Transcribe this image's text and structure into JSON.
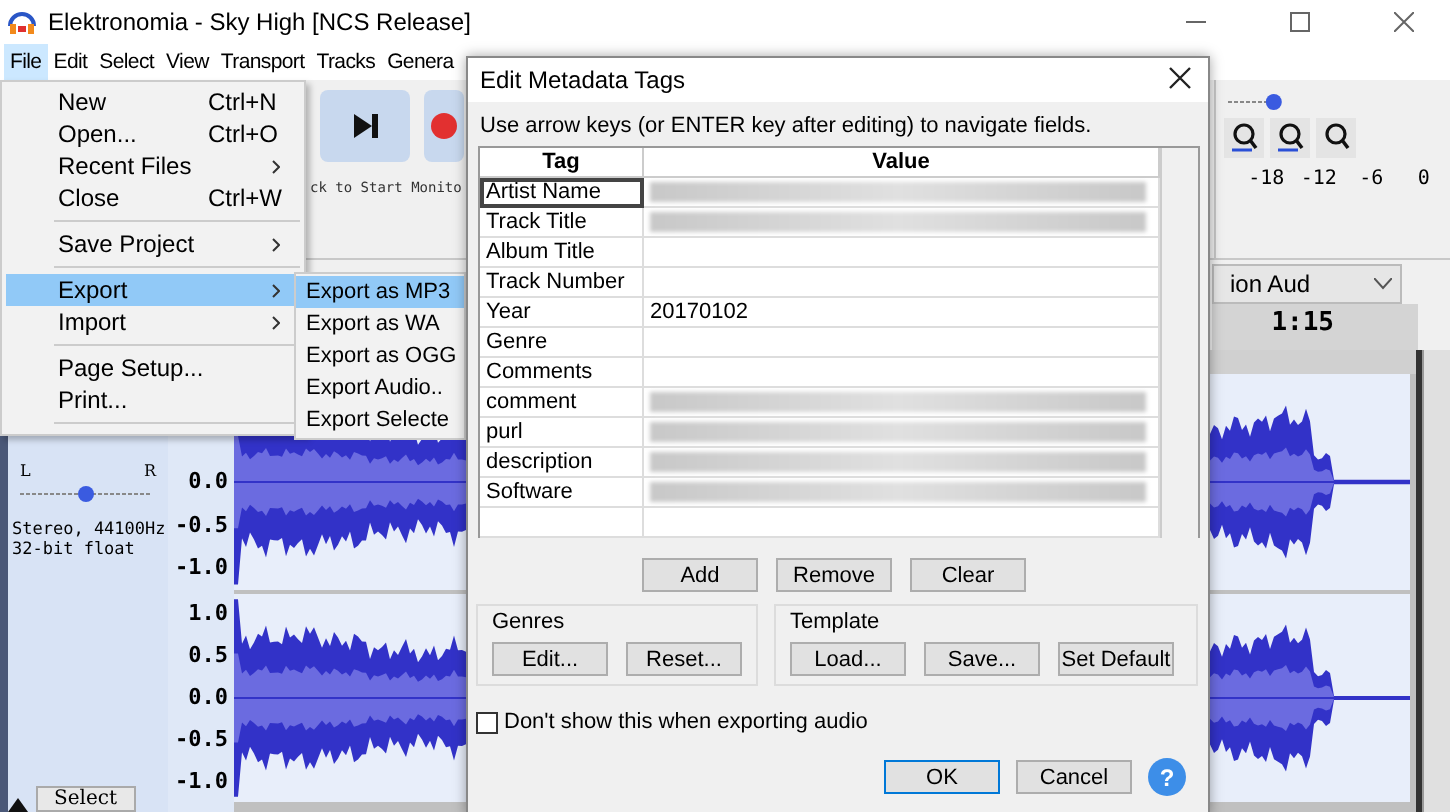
{
  "window": {
    "title": "Elektronomia - Sky High [NCS Release]"
  },
  "menu_bar": [
    {
      "label": "File",
      "selected": true
    },
    {
      "label": "Edit",
      "selected": false
    },
    {
      "label": "Select",
      "selected": false
    },
    {
      "label": "View",
      "selected": false
    },
    {
      "label": "Transport",
      "selected": false
    },
    {
      "label": "Tracks",
      "selected": false
    },
    {
      "label": "Genera",
      "selected": false
    }
  ],
  "file_menu": [
    {
      "kind": "item",
      "label": "New",
      "shortcut": "Ctrl+N",
      "submenu": false,
      "selected": false
    },
    {
      "kind": "item",
      "label": "Open...",
      "shortcut": "Ctrl+O",
      "submenu": false,
      "selected": false
    },
    {
      "kind": "item",
      "label": "Recent Files",
      "submenu": true,
      "selected": false
    },
    {
      "kind": "item",
      "label": "Close",
      "shortcut": "Ctrl+W",
      "submenu": false,
      "selected": false
    },
    {
      "kind": "separator"
    },
    {
      "kind": "item",
      "label": "Save Project",
      "submenu": true,
      "selected": false
    },
    {
      "kind": "separator"
    },
    {
      "kind": "item",
      "label": "Export",
      "submenu": true,
      "selected": true
    },
    {
      "kind": "item",
      "label": "Import",
      "submenu": true,
      "selected": false
    },
    {
      "kind": "separator"
    },
    {
      "kind": "item",
      "label": "Page Setup...",
      "submenu": false,
      "selected": false
    },
    {
      "kind": "item",
      "label": "Print...",
      "submenu": false,
      "selected": false
    },
    {
      "kind": "separator"
    }
  ],
  "export_submenu": [
    {
      "label": "Export as MP3",
      "selected": true
    },
    {
      "label": "Export as WA",
      "selected": false
    },
    {
      "label": "Export as OGG",
      "selected": false
    },
    {
      "label": "Export Audio..",
      "selected": false
    },
    {
      "label": "Export Selecte",
      "selected": false
    }
  ],
  "toolbar": {
    "monitor_hint": "ck to Start Monito",
    "slider": {
      "level": 0.95
    },
    "meter_ticks": [
      "-18",
      "-12",
      "-6",
      "0"
    ]
  },
  "device_dropdown": {
    "value": "ion Aud"
  },
  "timeline": {
    "label": "1:15"
  },
  "track": {
    "pan": {
      "labels": [
        "L",
        "R"
      ],
      "level": 0.5
    },
    "info": [
      "Stereo, 44100Hz",
      "32-bit float"
    ],
    "select_button": "Select",
    "channels": [
      {
        "scale": [
          "0.0",
          "-0.5",
          "-1.0"
        ]
      },
      {
        "scale": [
          "1.0",
          "0.5",
          "0.0",
          "-0.5",
          "-1.0"
        ]
      }
    ]
  },
  "dialog": {
    "title": "Edit Metadata Tags",
    "hint": "Use arrow keys (or ENTER key after editing) to navigate fields.",
    "columns": [
      "Tag",
      "Value"
    ],
    "rows": [
      {
        "tag": "Artist Name",
        "blurred": true,
        "focused": true
      },
      {
        "tag": "Track Title",
        "blurred": true,
        "focused": false
      },
      {
        "tag": "Album Title",
        "blurred": false,
        "focused": false
      },
      {
        "tag": "Track Number",
        "blurred": false,
        "focused": false
      },
      {
        "tag": "Year",
        "value": "20170102",
        "blurred": false,
        "focused": false
      },
      {
        "tag": "Genre",
        "blurred": false,
        "focused": false
      },
      {
        "tag": "Comments",
        "blurred": false,
        "focused": false
      },
      {
        "tag": "comment",
        "blurred": true,
        "focused": false
      },
      {
        "tag": "purl",
        "blurred": true,
        "focused": false
      },
      {
        "tag": "description",
        "blurred": true,
        "focused": false
      },
      {
        "tag": "Software",
        "blurred": true,
        "focused": false
      }
    ],
    "row_buttons": [
      "Add",
      "Remove",
      "Clear"
    ],
    "genres": {
      "title": "Genres",
      "buttons": [
        "Edit...",
        "Reset..."
      ]
    },
    "template": {
      "title": "Template",
      "buttons": [
        "Load...",
        "Save...",
        "Set Default"
      ]
    },
    "dont_show": {
      "label": "Don't show this when exporting audio",
      "checked": false
    },
    "buttons": [
      {
        "label": "OK",
        "default": true
      },
      {
        "label": "Cancel",
        "default": false
      }
    ],
    "help": "?"
  }
}
